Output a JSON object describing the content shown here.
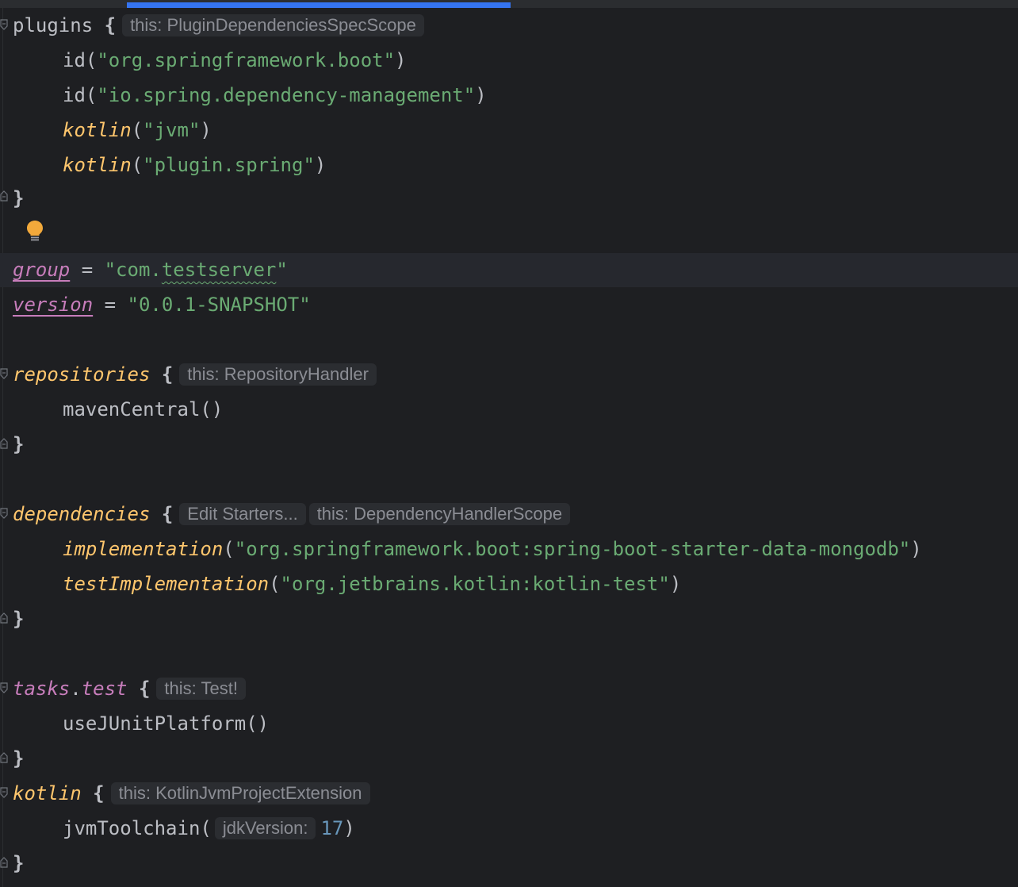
{
  "editor": {
    "colors": {
      "background": "#1e1f22",
      "keyword_fn": "#ffc66d",
      "string": "#6aab73",
      "property": "#c77dbb",
      "number": "#6897bb",
      "hint_bg": "#2b2d31",
      "scroll_thumb": "#3574f0"
    },
    "plugins": {
      "keyword": "plugins",
      "open": " {",
      "hint": "this: PluginDependenciesSpecScope",
      "items": [
        {
          "fn": "id",
          "open": "(",
          "arg": "\"org.springframework.boot\"",
          "close": ")"
        },
        {
          "fn": "id",
          "open": "(",
          "arg": "\"io.spring.dependency-management\"",
          "close": ")"
        },
        {
          "fn": "kotlin",
          "open": "(",
          "arg": "\"jvm\"",
          "close": ")"
        },
        {
          "fn": "kotlin",
          "open": "(",
          "arg": "\"plugin.spring\"",
          "close": ")"
        }
      ],
      "close": "}"
    },
    "intention_icon": "lightbulb-icon",
    "group": {
      "name": "group",
      "eq": " = ",
      "value_prefix": "\"com.",
      "value_typo": "testserver",
      "value_suffix": "\""
    },
    "version": {
      "name": "version",
      "eq": " = ",
      "value": "\"0.0.1-SNAPSHOT\""
    },
    "repositories": {
      "keyword": "repositories",
      "open": " {",
      "hint": "this: RepositoryHandler",
      "body": "mavenCentral()",
      "close": "}"
    },
    "dependencies": {
      "keyword": "dependencies",
      "open": " {",
      "action_hint": "Edit Starters...",
      "hint": "this: DependencyHandlerScope",
      "items": [
        {
          "fn": "implementation",
          "open": "(",
          "arg": "\"org.springframework.boot:spring-boot-starter-data-mongodb\"",
          "close": ")"
        },
        {
          "fn": "testImplementation",
          "open": "(",
          "arg": "\"org.jetbrains.kotlin:kotlin-test\"",
          "close": ")"
        }
      ],
      "close": "}"
    },
    "tasks_test": {
      "receiver": "tasks",
      "dot": ".",
      "member": "test",
      "open": " {",
      "hint": "this: Test!",
      "body": "useJUnitPlatform()",
      "close": "}"
    },
    "kotlin_block": {
      "keyword": "kotlin",
      "open": " {",
      "hint": "this: KotlinJvmProjectExtension",
      "call": "jvmToolchain(",
      "param_hint": "jdkVersion:",
      "value": "17",
      "call_close": ")",
      "close": "}"
    }
  }
}
